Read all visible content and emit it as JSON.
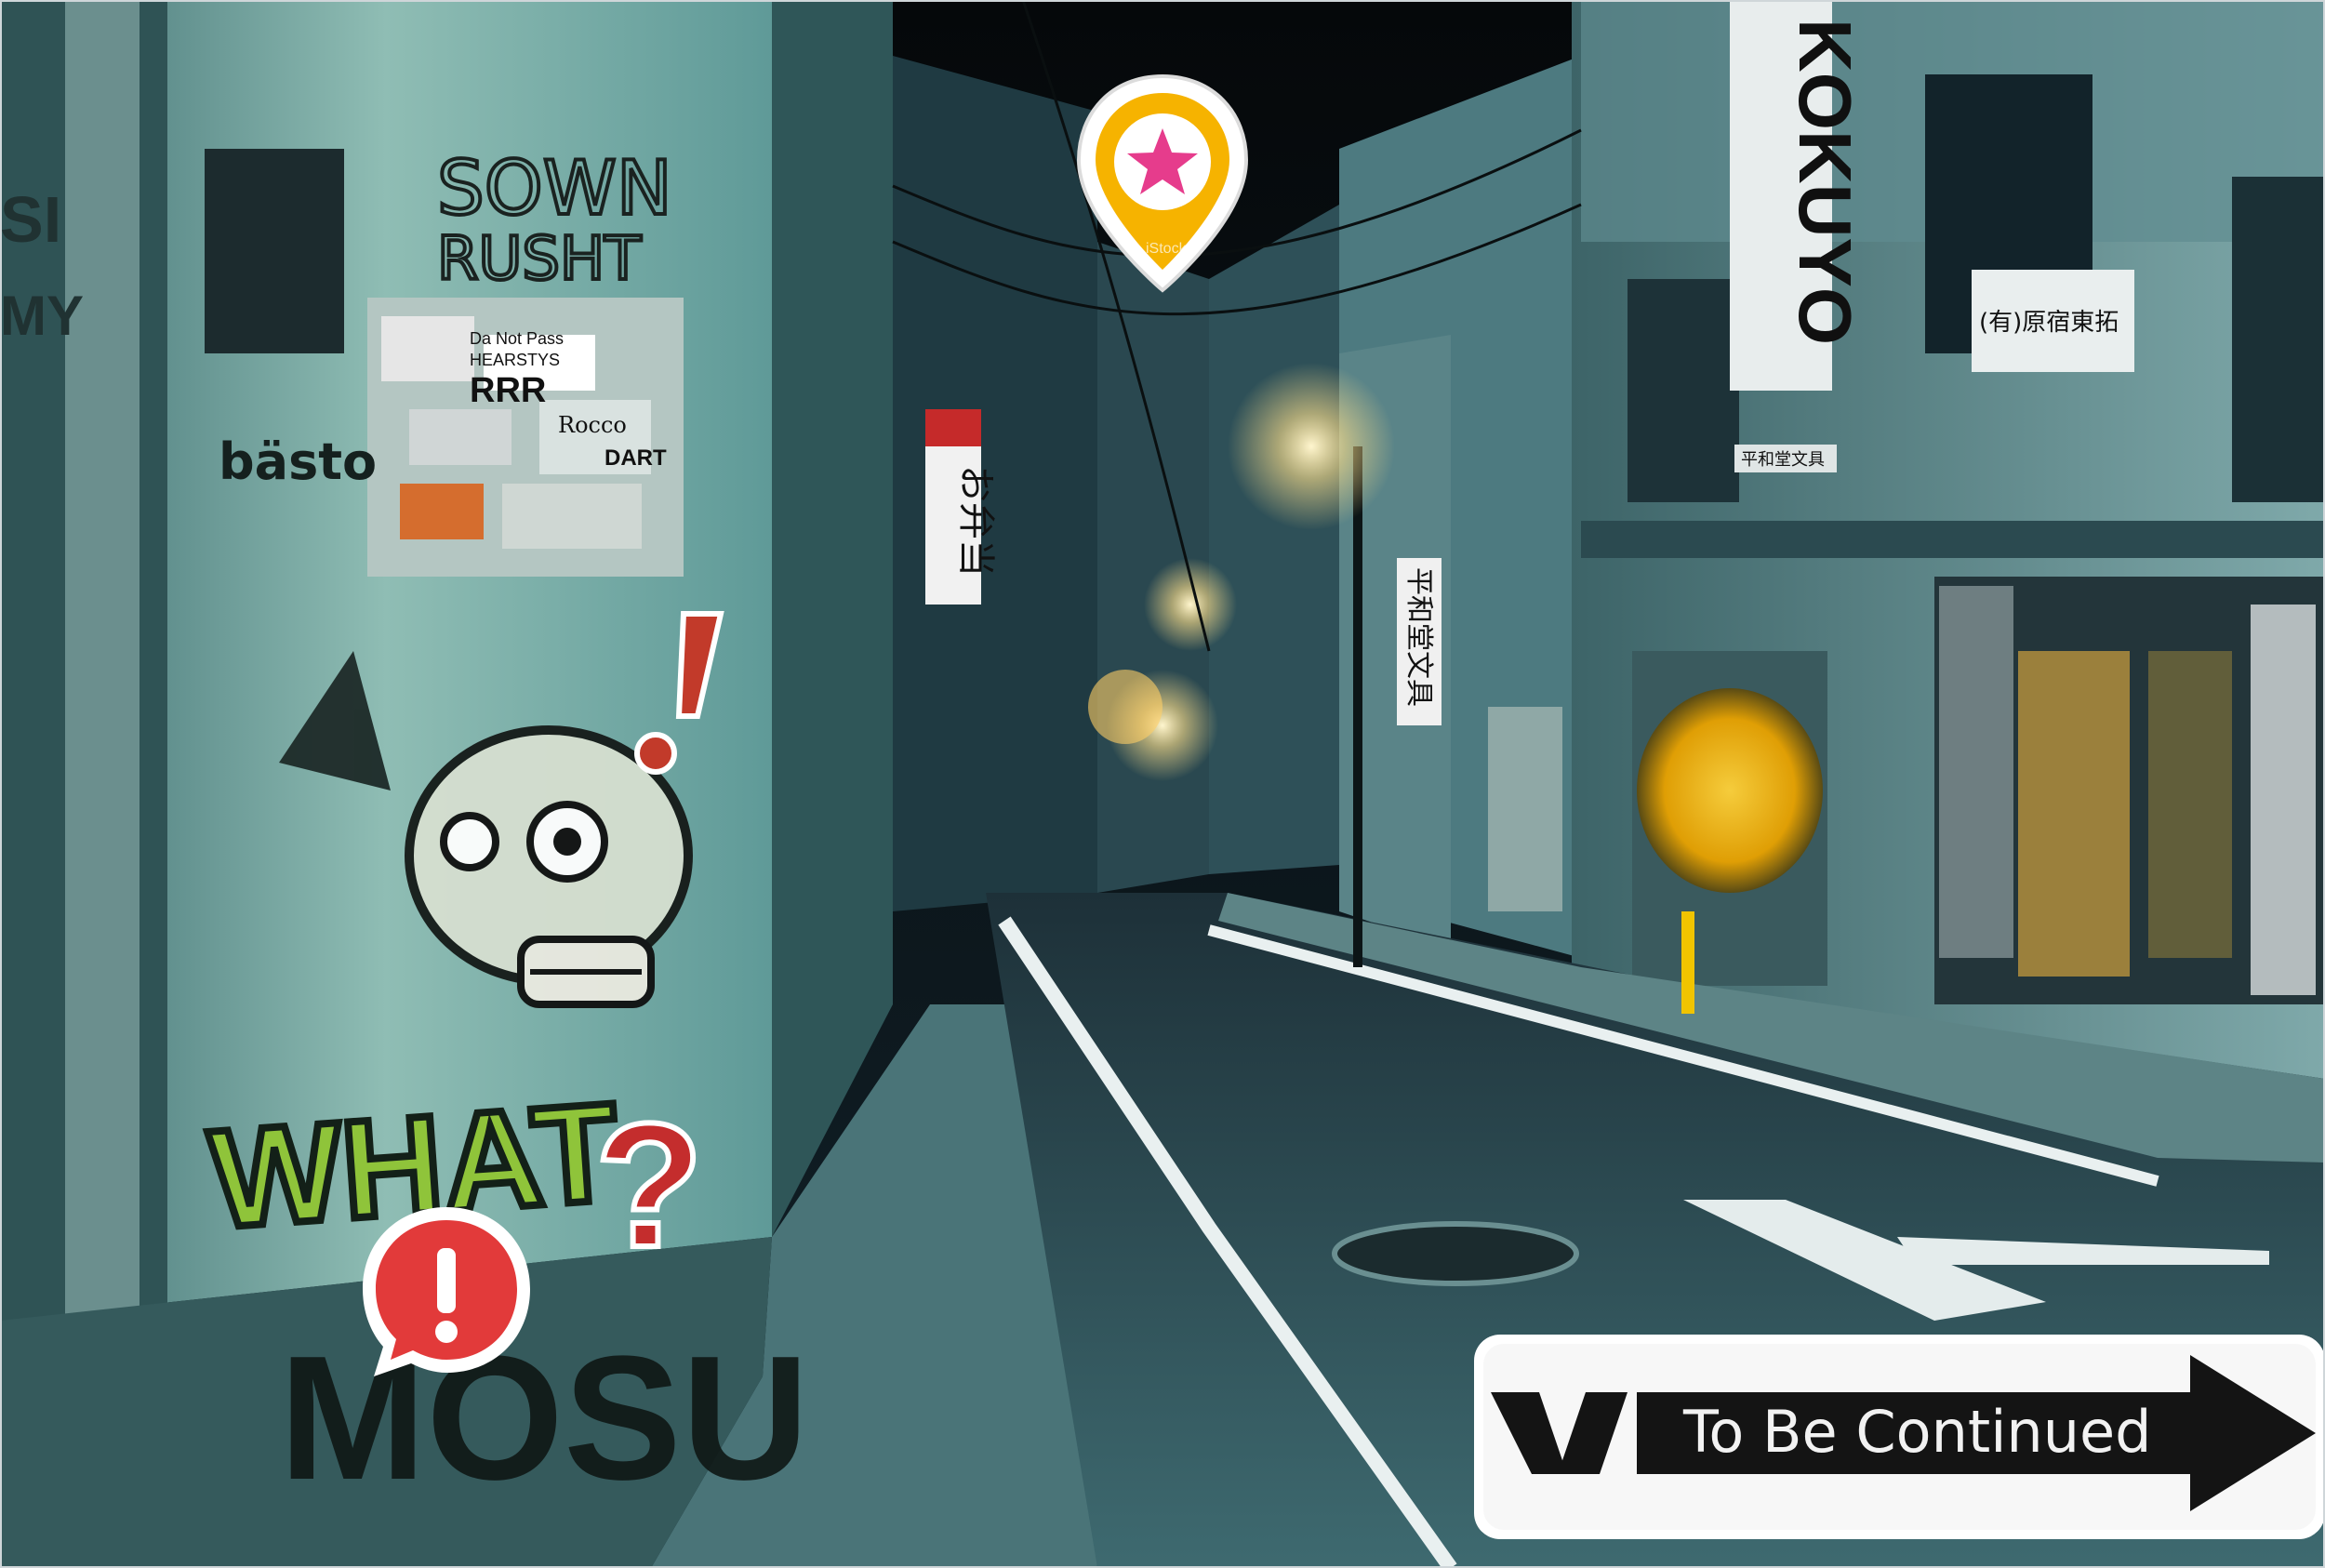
{
  "scene": {
    "colors": {
      "night": "#0a1418",
      "teal_wall": "#6fa8a6",
      "street": "#2c4a52",
      "street_light": "#ffe9a6",
      "accent_yellow": "#f6b300",
      "accent_pink": "#e63c8c",
      "alert_red": "#e23a3a"
    }
  },
  "graffiti": {
    "what": "WHAT",
    "question": "?",
    "tag_top": "SOWN",
    "tag_top2": "RUSHT",
    "basto": "bästo",
    "mosu": "MOSU",
    "left_edge1": "SI",
    "left_edge2": "MY",
    "stickers": [
      "Da Not Pass",
      "HEARSTYS",
      "RRR",
      "Rocco",
      "DART"
    ]
  },
  "signs": {
    "kokuyo": "KOKUYO",
    "shop_sign": "(有)原宿東拓",
    "bento": "お弁当",
    "heiwado": "平和堂文具",
    "store_small": "平和堂文具"
  },
  "markers": {
    "star": {
      "icon": "star-map-pin-icon",
      "color": "#f6b300",
      "watermark": "iStock"
    },
    "alert": {
      "icon": "alert-bubble-icon",
      "color": "#e23a3a"
    }
  },
  "continue_banner": {
    "label": "To Be Continued",
    "icon": "arrow-right-icon"
  }
}
